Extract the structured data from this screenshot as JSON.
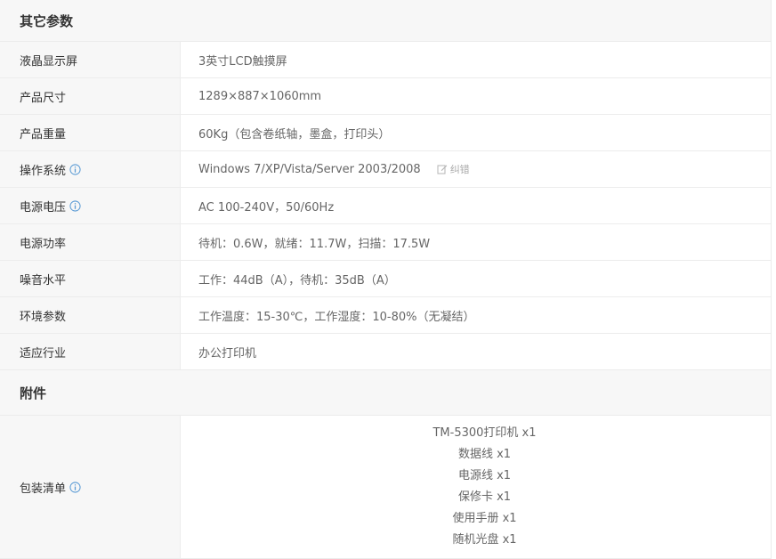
{
  "sections": [
    {
      "title": "其它参数"
    },
    {
      "title": "附件"
    }
  ],
  "other_params": [
    {
      "label": "液晶显示屏",
      "value": "3英寸LCD触摸屏"
    },
    {
      "label": "产品尺寸",
      "value": "1289×887×1060mm"
    },
    {
      "label": "产品重量",
      "value": "60Kg（包含卷纸轴，墨盒，打印头）"
    },
    {
      "label": "操作系统",
      "value": "Windows 7/XP/Vista/Server 2003/2008",
      "correct": "纠错"
    },
    {
      "label": "电源电压",
      "value": "AC 100-240V，50/60Hz"
    },
    {
      "label": "电源功率",
      "value": "待机：0.6W，就绪：11.7W，扫描：17.5W"
    },
    {
      "label": "噪音水平",
      "value": "工作：44dB（A），待机：35dB（A）"
    },
    {
      "label": "环境参数",
      "value": "工作温度：15-30℃，工作湿度：10-80%（无凝结）"
    },
    {
      "label": "适应行业",
      "value": "办公打印机"
    }
  ],
  "accessories": {
    "label": "包装清单",
    "items": [
      "TM-5300打印机 x1",
      "数据线 x1",
      "电源线 x1",
      "保修卡 x1",
      "使用手册 x1",
      "随机光盘 x1"
    ]
  },
  "colors": {
    "info_icon": "#5b9bd5",
    "label_bg": "#f7f7f7",
    "border": "#ececec"
  }
}
